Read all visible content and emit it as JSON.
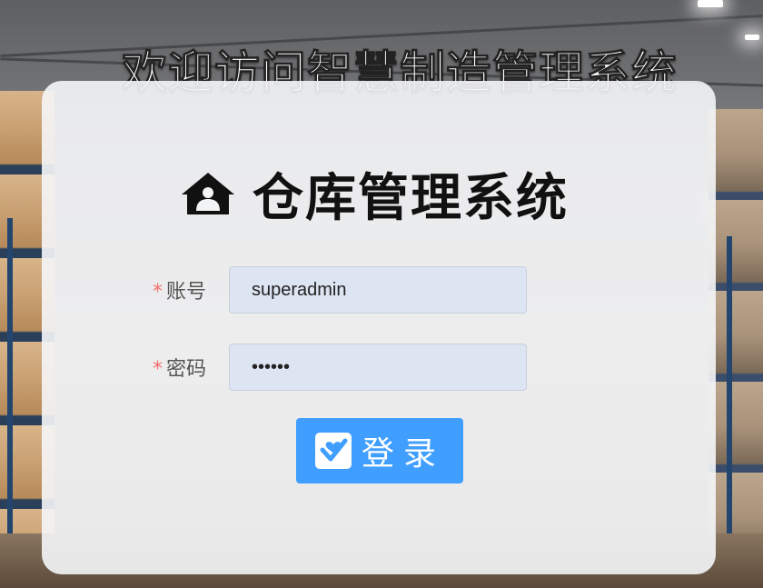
{
  "welcome_title": "欢迎访问智慧制造管理系统",
  "system": {
    "icon": "warehouse-home-icon",
    "title": "仓库管理系统"
  },
  "form": {
    "required_mark": "*",
    "username": {
      "label": "账号",
      "value": "superadmin"
    },
    "password": {
      "label": "密码",
      "value": "123456"
    },
    "login_button": {
      "icon": "check-square-icon",
      "label": "登录"
    }
  },
  "colors": {
    "accent": "#409eff",
    "required": "#f56c6c",
    "input_bg": "#dde4f2"
  }
}
